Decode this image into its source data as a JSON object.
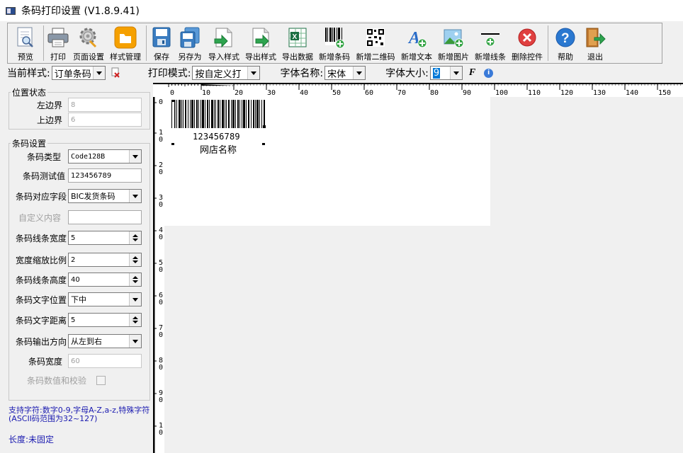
{
  "window": {
    "title": "条码打印设置 (V1.8.9.41)"
  },
  "toolbar": {
    "buttons": [
      {
        "label": "预览",
        "icon": "preview-icon"
      },
      {
        "label": "打印",
        "icon": "printer-icon"
      },
      {
        "label": "页面设置",
        "icon": "gear-icon"
      },
      {
        "label": "样式管理",
        "icon": "style-icon"
      },
      {
        "label": "保存",
        "icon": "save-icon"
      },
      {
        "label": "另存为",
        "icon": "save-as-icon"
      },
      {
        "label": "导入样式",
        "icon": "import-icon"
      },
      {
        "label": "导出样式",
        "icon": "export-icon"
      },
      {
        "label": "导出数据",
        "icon": "excel-icon"
      },
      {
        "label": "新增条码",
        "icon": "barcode-icon"
      },
      {
        "label": "新增二维码",
        "icon": "qrcode-icon"
      },
      {
        "label": "新增文本",
        "icon": "text-icon"
      },
      {
        "label": "新增图片",
        "icon": "image-icon"
      },
      {
        "label": "新增线条",
        "icon": "line-icon"
      },
      {
        "label": "删除控件",
        "icon": "delete-icon"
      },
      {
        "label": "帮助",
        "icon": "help-icon"
      },
      {
        "label": "退出",
        "icon": "exit-icon"
      }
    ]
  },
  "options": {
    "current_style_label": "当前样式:",
    "current_style_value": "订单条码",
    "print_mode_label": "打印模式:",
    "print_mode_value": "按自定义打",
    "font_name_label": "字体名称:",
    "font_name_value": "宋体",
    "font_size_label": "字体大小:",
    "font_size_value": "9",
    "bold_label": "F"
  },
  "position": {
    "legend": "位置状态",
    "left_label": "左边界",
    "left_value": "8",
    "top_label": "上边界",
    "top_value": "6"
  },
  "barcode": {
    "legend": "条码设置",
    "type_label": "条码类型",
    "type_value": "Code128B",
    "test_label": "条码测试值",
    "test_value": "123456789",
    "field_label": "条码对应字段",
    "field_value": "BIC发货条码",
    "custom_label": "自定义内容",
    "custom_value": "",
    "line_width_label": "条码线条宽度",
    "line_width_value": "5",
    "scale_label": "宽度缩放比例",
    "scale_value": "2",
    "height_label": "条码线条高度",
    "height_value": "40",
    "text_pos_label": "条码文字位置",
    "text_pos_value": "下中",
    "text_dist_label": "条码文字距离",
    "text_dist_value": "5",
    "direction_label": "条码输出方向",
    "direction_value": "从左到右",
    "width_label": "条码宽度",
    "width_value": "60",
    "checksum_label": "条码数值和校验"
  },
  "help_text": "支持字符:数字0-9,字母A-Z,a-z,特殊字符(ASCII码范围为32~127)",
  "length_text": "长度:未固定",
  "canvas": {
    "barcode_number": "123456789",
    "shop_name": "网店名称",
    "h_ruler_labels": [
      "0",
      "10",
      "20",
      "30",
      "40",
      "50",
      "60",
      "70",
      "80",
      "90",
      "100",
      "110",
      "120",
      "130",
      "140",
      "150"
    ],
    "v_ruler_labels": [
      "0",
      "1\n0",
      "2\n0",
      "3\n0",
      "4\n0",
      "5\n0",
      "6\n0",
      "7\n0",
      "8\n0",
      "9\n0",
      "1\n0"
    ]
  }
}
